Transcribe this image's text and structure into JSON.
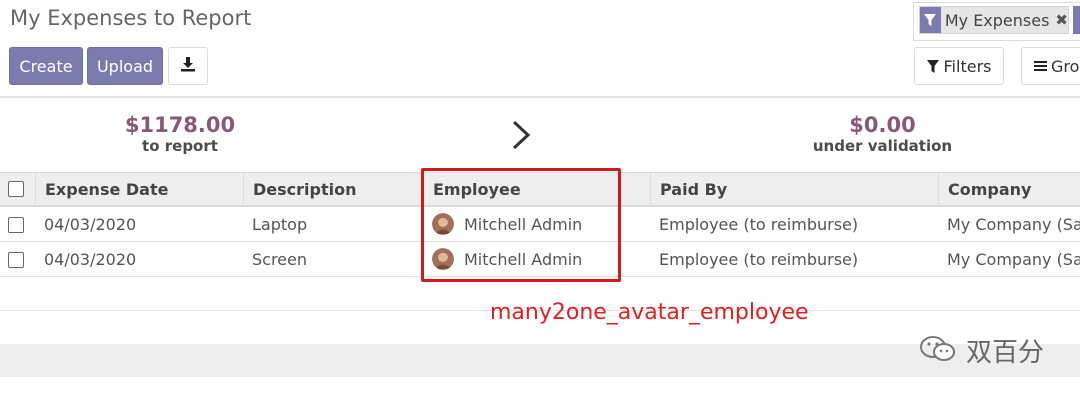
{
  "header": {
    "title": "My Expenses to Report",
    "search_facet": "My Expenses",
    "search_facet_close": "✖",
    "create_label": "Create",
    "upload_label": "Upload",
    "filters_label": "Filters",
    "group_label": "Gro"
  },
  "dashboard": {
    "to_report_amount": "$1178.00",
    "to_report_label": "to report",
    "validation_amount": "$0.00",
    "validation_label": "under validation"
  },
  "table": {
    "columns": [
      "Expense Date",
      "Description",
      "Employee",
      "Paid By",
      "Company"
    ],
    "rows": [
      {
        "date": "04/03/2020",
        "description": "Laptop",
        "employee": "Mitchell Admin",
        "paid_by": "Employee (to reimburse)",
        "company": "My Company (San"
      },
      {
        "date": "04/03/2020",
        "description": "Screen",
        "employee": "Mitchell Admin",
        "paid_by": "Employee (to reimburse)",
        "company": "My Company (San"
      }
    ]
  },
  "annotation": {
    "text": "many2one_avatar_employee",
    "color": "#e02020"
  },
  "watermark": {
    "text": "双百分"
  },
  "colors": {
    "primary": "#7c7bad",
    "amount": "#875a7b",
    "highlight": "#d21a1a"
  }
}
